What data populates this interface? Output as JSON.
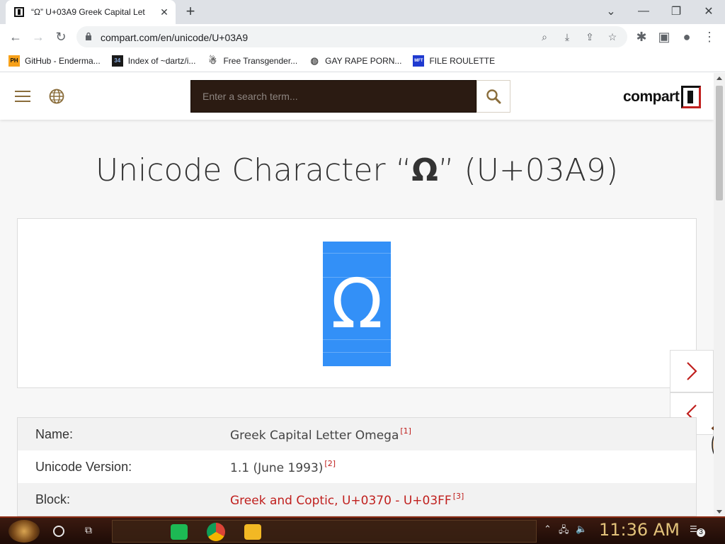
{
  "browser": {
    "tab_title": "“Ω” U+03A9 Greek Capital Let",
    "url": "compart.com/en/unicode/U+03A9",
    "bookmarks": [
      {
        "label": "GitHub - Enderma...",
        "icon": "PH"
      },
      {
        "label": "Index of ~dartz/i...",
        "icon": "34"
      },
      {
        "label": "Free Transgender...",
        "icon": "ghost-icon"
      },
      {
        "label": "GAY RAPE PORN...",
        "icon": "globe-icon"
      },
      {
        "label": "FILE ROULETTE",
        "icon": "MFT"
      }
    ]
  },
  "site": {
    "search_placeholder": "Enter a search term...",
    "logo_text": "compart"
  },
  "page": {
    "title_prefix": "Unicode Character “",
    "title_char": "Ω",
    "title_suffix": "” (U+03A9)",
    "glyph": "Ω",
    "glyph_color": "#3390f7"
  },
  "properties": [
    {
      "key": "Name:",
      "value": "Greek Capital Letter Omega",
      "ref": "[1]",
      "link": false
    },
    {
      "key": "Unicode Version:",
      "value": "1.1 (June 1993)",
      "ref": "[2]",
      "link": false
    },
    {
      "key": "Block:",
      "value": "Greek and Coptic, U+0370 - U+03FF",
      "ref": "[3]",
      "link": true
    }
  ],
  "taskbar": {
    "clock": "11:36 AM",
    "notification_count": "3"
  }
}
